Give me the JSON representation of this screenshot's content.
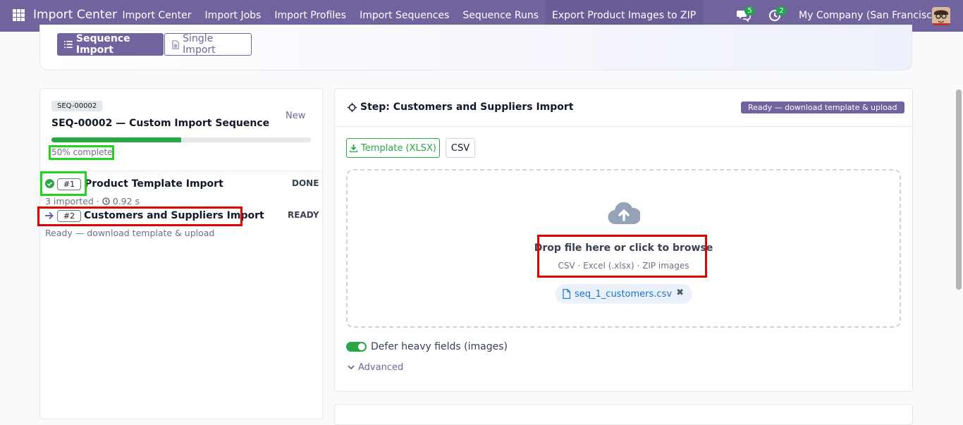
{
  "navbar": {
    "brand": "Import Center",
    "menu": [
      "Import Center",
      "Import Jobs",
      "Import Profiles",
      "Import Sequences",
      "Sequence Runs",
      "Export Product Images to ZIP"
    ],
    "messages_count": "5",
    "activities_count": "2",
    "company": "My Company (San Francisco)"
  },
  "mode": {
    "sequence_label": "Sequence Import",
    "single_label": "Single Import"
  },
  "sequence": {
    "code": "SEQ-00002",
    "status": "New",
    "title": "SEQ-00002 — Custom Import Sequence",
    "progress_percent": 50,
    "progress_label": "50% complete",
    "steps": [
      {
        "num": "#1",
        "name": "Product Template Import",
        "state": "DONE",
        "meta_imported": "3 imported ·",
        "meta_time": "0.92 s"
      },
      {
        "num": "#2",
        "name": "Customers and Suppliers Import",
        "state": "READY",
        "meta": "Ready — download template & upload"
      }
    ]
  },
  "step_panel": {
    "title": "Step: Customers and Suppliers Import",
    "status": "Ready — download template & upload",
    "template_xlsx": "Template (XLSX)",
    "template_csv": "CSV",
    "drop_title": "Drop file here or click to browse",
    "drop_hint": "CSV · Excel (.xlsx) · ZIP images",
    "file_name": "seq_1_customers.csv",
    "remove_symbol": "✖",
    "defer_label": "Defer heavy fields (images)",
    "defer_enabled": true,
    "advanced_label": "Advanced"
  },
  "colors": {
    "brand": "#71639e",
    "success": "#28a745",
    "highlight_green": "#22d322",
    "highlight_red": "#e00000"
  }
}
